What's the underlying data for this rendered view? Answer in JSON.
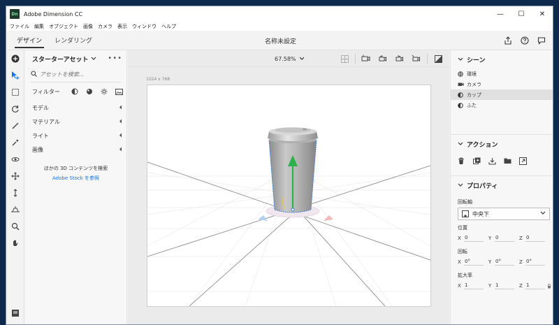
{
  "window": {
    "title": "Adobe Dimension CC",
    "logo_text": "Dn",
    "controls": {
      "minimize": "—",
      "maximize": "☐",
      "close": "✕"
    }
  },
  "menu": [
    "ファイル",
    "編集",
    "オブジェクト",
    "画像",
    "カメラ",
    "表示",
    "ウィンドウ",
    "ヘルプ"
  ],
  "modes": {
    "design": "デザイン",
    "render": "レンダリング"
  },
  "document": {
    "title": "名称未設定"
  },
  "assets": {
    "title": "スターターアセット",
    "search_placeholder": "アセットを検索...",
    "filter_label": "フィルター",
    "categories": [
      "モデル",
      "マテリアル",
      "ライト",
      "画像"
    ],
    "search_more_text": "ほかの 3D コンテンツを検索",
    "stock_link": "Adobe Stock を参照"
  },
  "viewport": {
    "zoom": "67.58%",
    "canvas_size": "1024 x 768"
  },
  "scene": {
    "title": "シーン",
    "items": [
      {
        "label": "環境",
        "icon": "environment-icon"
      },
      {
        "label": "カメラ",
        "icon": "camera-icon"
      },
      {
        "label": "カップ",
        "icon": "model-icon",
        "selected": true
      },
      {
        "label": "ふた",
        "icon": "model-icon"
      }
    ]
  },
  "actions": {
    "title": "アクション",
    "icons": [
      "trash-icon",
      "duplicate-icon",
      "download-icon",
      "folder-icon",
      "export-icon"
    ]
  },
  "properties": {
    "title": "プロパティ",
    "pivot_label": "回転軸",
    "pivot_value": "中央下",
    "position_label": "位置",
    "position": {
      "x": "0",
      "y": "0",
      "z": "0"
    },
    "rotation_label": "回転",
    "rotation": {
      "x": "0°",
      "y": "0°",
      "z": "0°"
    },
    "scale_label": "拡大率",
    "scale": {
      "x": "1",
      "y": "1",
      "z": "1"
    }
  },
  "axes": {
    "x": "X",
    "y": "Y",
    "z": "Z"
  },
  "colors": {
    "accent": "#1473e6",
    "gizmo_up": "#2db24b",
    "selection": "#3a7bd5"
  }
}
